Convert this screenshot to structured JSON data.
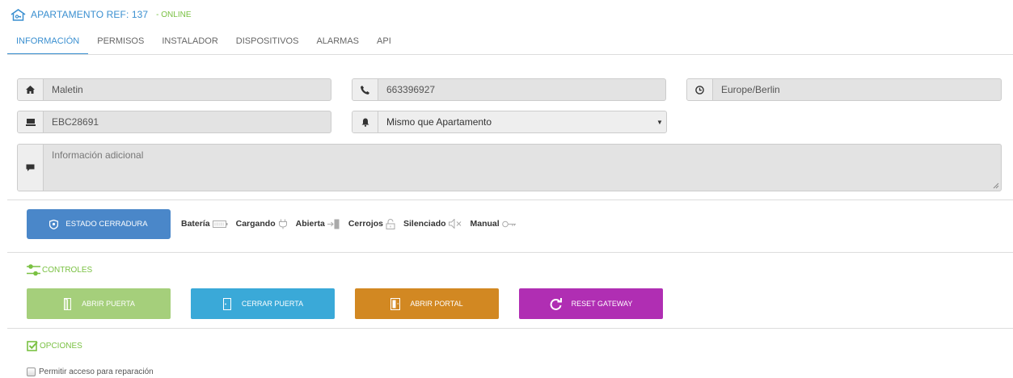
{
  "header": {
    "title": "APARTAMENTO REF: 137",
    "status": "- ONLINE"
  },
  "tabs": [
    {
      "label": "INFORMACIÓN"
    },
    {
      "label": "PERMISOS"
    },
    {
      "label": "INSTALADOR"
    },
    {
      "label": "DISPOSITIVOS"
    },
    {
      "label": "ALARMAS"
    },
    {
      "label": "API"
    }
  ],
  "fields": {
    "name": "Maletin",
    "phone": "663396927",
    "timezone": "Europe/Berlin",
    "device_id": "EBC28691",
    "notification": "Mismo que Apartamento",
    "info_placeholder": "Información adicional"
  },
  "lock": {
    "button_label": "ESTADO CERRADURA",
    "status": [
      "Batería",
      "Cargando",
      "Abierta",
      "Cerrojos",
      "Silenciado",
      "Manual"
    ]
  },
  "controls": {
    "title": "CONTROLES",
    "open_door": "ABRIR PUERTA",
    "close_door": "CERRAR PUERTA",
    "open_portal": "ABRIR PORTAL",
    "reset_gateway": "RESET GATEWAY"
  },
  "options": {
    "title": "OPCIONES",
    "repair_access": "Permitir acceso para reparación"
  },
  "colors": {
    "primary": "#4a87c9",
    "online": "#7ac143",
    "open_door": "#a5cf7b",
    "close_door": "#3aa9d8",
    "open_portal": "#d28822",
    "reset_gateway": "#b02eb3"
  }
}
